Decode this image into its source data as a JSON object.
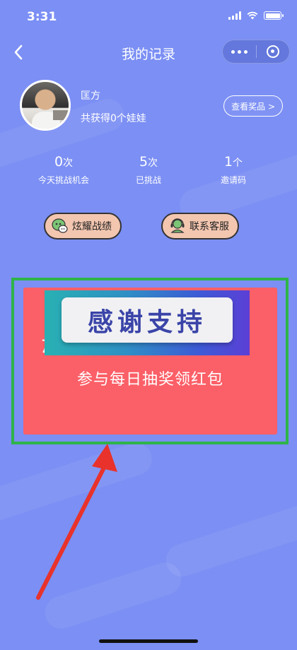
{
  "status": {
    "time": "3:31"
  },
  "nav": {
    "title": "我的记录"
  },
  "profile": {
    "name": "匡方",
    "summary": "共获得0个娃娃",
    "prize_button": "查看奖品 >"
  },
  "stats": [
    {
      "value": "0",
      "unit": "次",
      "label": "今天挑战机会"
    },
    {
      "value": "5",
      "unit": "次",
      "label": "已挑战"
    },
    {
      "value": "1",
      "unit": "个",
      "label": "邀请码"
    }
  ],
  "actions": {
    "show_off": "炫耀战绩",
    "support": "联系客服"
  },
  "promo": {
    "partial_char": "た",
    "banner_text": "感谢支持",
    "subtitle": "参与每日抽奖领红包"
  },
  "colors": {
    "background": "#7b8ff4",
    "promo_card": "#fb5f67",
    "highlight_frame": "#2fb34a",
    "action_button": "#f3c6b0",
    "annotation_arrow": "#e8322b"
  }
}
